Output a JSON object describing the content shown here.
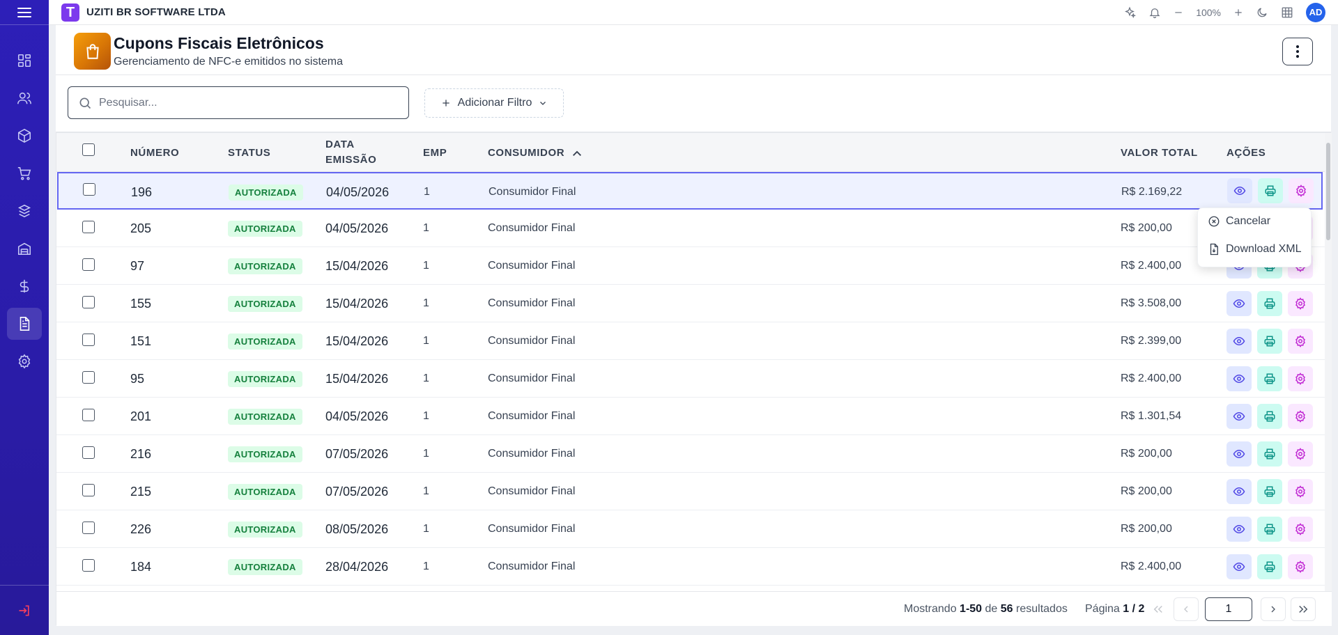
{
  "app": {
    "company": "UZITI BR SOFTWARE LTDA",
    "logo_letter": "T",
    "zoom": "100%",
    "avatar_initials": "AD"
  },
  "colors": {
    "sidebar": "#2d1fb8",
    "accent": "#6366f1",
    "header_icon": "#d97706",
    "badge_bg": "#dcfce7",
    "badge_text": "#15803d"
  },
  "sidebar": {
    "items": [
      {
        "name": "dashboard",
        "icon": "grid-icon"
      },
      {
        "name": "users",
        "icon": "users-icon"
      },
      {
        "name": "products",
        "icon": "box-icon"
      },
      {
        "name": "sales",
        "icon": "cart-icon"
      },
      {
        "name": "inventory",
        "icon": "stack-box-icon"
      },
      {
        "name": "warehouse",
        "icon": "warehouse-icon"
      },
      {
        "name": "finance",
        "icon": "dollar-icon"
      },
      {
        "name": "documents",
        "icon": "document-icon",
        "active": true
      },
      {
        "name": "settings",
        "icon": "gear-icon"
      }
    ],
    "logout_icon": "logout-icon"
  },
  "page": {
    "title": "Cupons Fiscais Eletrônicos",
    "subtitle": "Gerenciamento de NFC-e emitidos no sistema"
  },
  "filters": {
    "search_placeholder": "Pesquisar...",
    "add_filter_label": "Adicionar Filtro"
  },
  "table": {
    "headers": {
      "numero": "NÚMERO",
      "status": "STATUS",
      "data_line1": "DATA",
      "data_line2": "EMISSÃO",
      "emp": "EMP",
      "consumidor": "CONSUMIDOR",
      "valor": "VALOR TOTAL",
      "acoes": "AÇÕES"
    },
    "sort": {
      "column": "consumidor",
      "direction": "asc"
    },
    "rows": [
      {
        "numero": "196",
        "status": "AUTORIZADA",
        "data": "04/05/2026",
        "emp": "1",
        "consumidor": "Consumidor Final",
        "valor": "R$ 2.169,22"
      },
      {
        "numero": "205",
        "status": "AUTORIZADA",
        "data": "04/05/2026",
        "emp": "1",
        "consumidor": "Consumidor Final",
        "valor": "R$ 200,00"
      },
      {
        "numero": "97",
        "status": "AUTORIZADA",
        "data": "15/04/2026",
        "emp": "1",
        "consumidor": "Consumidor Final",
        "valor": "R$ 2.400,00"
      },
      {
        "numero": "155",
        "status": "AUTORIZADA",
        "data": "15/04/2026",
        "emp": "1",
        "consumidor": "Consumidor Final",
        "valor": "R$ 3.508,00"
      },
      {
        "numero": "151",
        "status": "AUTORIZADA",
        "data": "15/04/2026",
        "emp": "1",
        "consumidor": "Consumidor Final",
        "valor": "R$ 2.399,00"
      },
      {
        "numero": "95",
        "status": "AUTORIZADA",
        "data": "15/04/2026",
        "emp": "1",
        "consumidor": "Consumidor Final",
        "valor": "R$ 2.400,00"
      },
      {
        "numero": "201",
        "status": "AUTORIZADA",
        "data": "04/05/2026",
        "emp": "1",
        "consumidor": "Consumidor Final",
        "valor": "R$ 1.301,54"
      },
      {
        "numero": "216",
        "status": "AUTORIZADA",
        "data": "07/05/2026",
        "emp": "1",
        "consumidor": "Consumidor Final",
        "valor": "R$ 200,00"
      },
      {
        "numero": "215",
        "status": "AUTORIZADA",
        "data": "07/05/2026",
        "emp": "1",
        "consumidor": "Consumidor Final",
        "valor": "R$ 200,00"
      },
      {
        "numero": "226",
        "status": "AUTORIZADA",
        "data": "08/05/2026",
        "emp": "1",
        "consumidor": "Consumidor Final",
        "valor": "R$ 200,00"
      },
      {
        "numero": "184",
        "status": "AUTORIZADA",
        "data": "28/04/2026",
        "emp": "1",
        "consumidor": "Consumidor Final",
        "valor": "R$ 2.400,00"
      }
    ]
  },
  "dropdown": {
    "items": [
      {
        "label": "Cancelar",
        "icon": "x-circle-icon"
      },
      {
        "label": "Download XML",
        "icon": "file-download-icon"
      }
    ]
  },
  "pagination": {
    "showing_prefix": "Mostrando",
    "range": "1-50",
    "of": "de",
    "total": "56",
    "results": "resultados",
    "page_prefix": "Página",
    "current": "1",
    "sep": "/",
    "pages": "2",
    "input_value": "1"
  }
}
